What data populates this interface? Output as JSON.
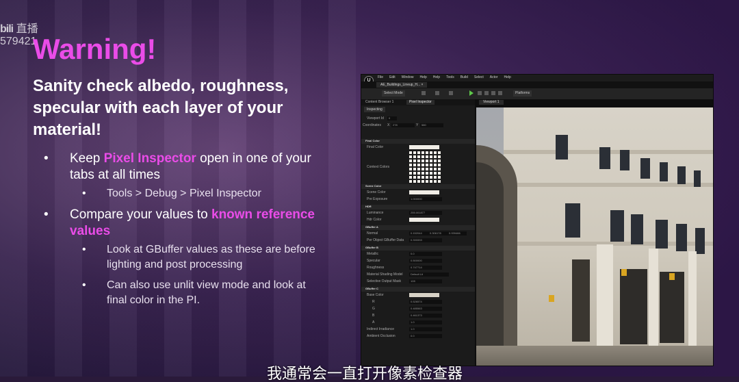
{
  "watermark": {
    "logo": "bili",
    "label": "直播",
    "id": "579421"
  },
  "slide": {
    "title": "Warning!",
    "intro": "Sanity check albedo, roughness, specular with each layer of your material!",
    "bullets": [
      {
        "pre": "Keep ",
        "highlight": "Pixel Inspector",
        "post": " open in one of your tabs at all times",
        "sub": [
          "Tools > Debug > Pixel Inspector"
        ]
      },
      {
        "pre": "Compare your values to ",
        "highlight": "known reference values",
        "post": "",
        "sub": [
          "Look at GBuffer values as these are before lighting and post processing",
          "Can also use unlit view mode and look at final color in the PI."
        ]
      }
    ]
  },
  "editor": {
    "logo": "U",
    "menu": [
      "File",
      "Edit",
      "Window",
      "Help",
      "Help",
      "Tools",
      "Build",
      "Select",
      "Actor",
      "Help"
    ],
    "level_tab": "AE_Buildings_Lineup_H... ×",
    "toolbar": {
      "select_mode": "Select Mode",
      "platforms": "Platforms"
    },
    "tabs": {
      "content_browser": "Content Browser 1",
      "pixel_inspector": "Pixel Inspector",
      "viewport": "Viewport 1"
    },
    "inspecting": "Inspecting",
    "viewport_id_label": "Viewport Id",
    "viewport_id_value": "0",
    "coordinates_label": "Coordinates",
    "coord_x_label": "X",
    "coord_x": "278",
    "coord_y_label": "Y",
    "coord_y": "580",
    "sections": {
      "final_color": "Final Color",
      "scene_color": "Scene Color",
      "hdr": "HDR",
      "gbuffer_a": "GBuffer A",
      "gbuffer_b": "GBuffer B",
      "gbuffer_c": "GBuffer C"
    },
    "final_color_label": "Final Color",
    "context_colors_label": "Context Colors",
    "scene_color_label": "Scene Color",
    "pre_exposure_label": "Pre Exposure",
    "pre_exposure": "1.000000",
    "luminance_label": "Luminance",
    "luminance": "255.001877",
    "hdr_color_label": "Hdr Color",
    "normal_label": "Normal",
    "normal": [
      "0.152044",
      "0.306178",
      "0.939466"
    ],
    "per_object_label": "Per Object GBuffer Data",
    "per_object": "0.333333",
    "metallic_label": "Metallic",
    "metallic": "0.0",
    "specular_label": "Specular",
    "specular": "0.500000",
    "roughness_label": "Roughness",
    "roughness": "0.747714",
    "shading_model_label": "Material Shading Model",
    "shading_model": "Default Lit",
    "selective_mask_label": "Selective Output Mask",
    "selective_mask": "128",
    "base_color_label": "Base Color",
    "base_r": "0.526574",
    "base_g": "0.485563",
    "base_b": "0.461373",
    "base_a": "1.0",
    "indirect_irradiance_label": "Indirect Irradiance",
    "indirect_irradiance": "1.0",
    "ambient_occlusion_label": "Ambient Occlusion",
    "ambient_occlusion": "0.0",
    "channel_labels": [
      "R",
      "G",
      "B",
      "A"
    ]
  },
  "subtitle": "我通常会一直打开像素检查器"
}
